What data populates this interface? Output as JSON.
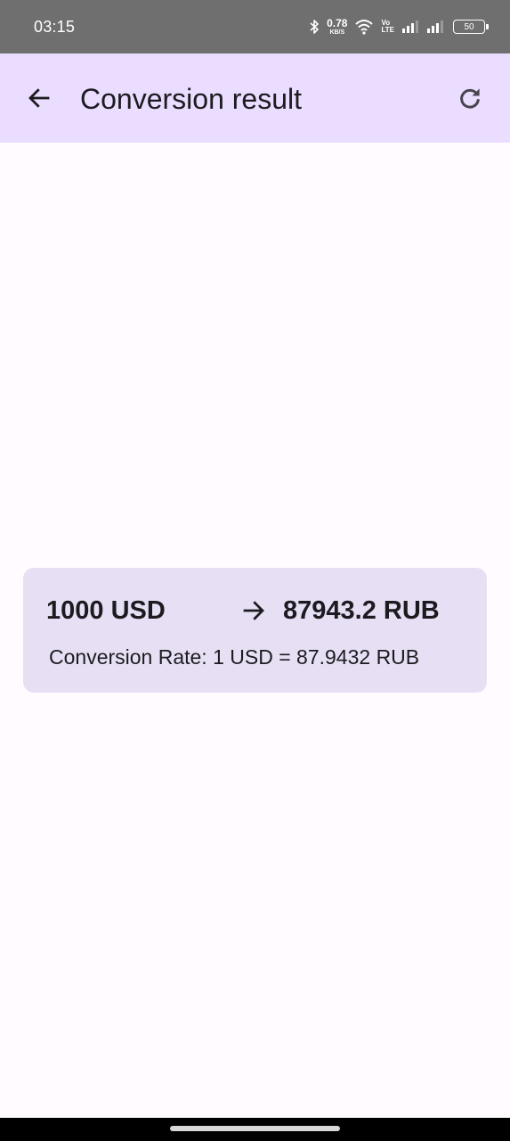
{
  "status_bar": {
    "time": "03:15",
    "net_speed_value": "0.78",
    "net_speed_unit": "KB/S",
    "volte_top": "Vo",
    "volte_bottom": "LTE",
    "battery_level": "50",
    "icons": [
      "bluetooth-icon",
      "wifi-icon",
      "signal-icon",
      "signal-icon"
    ]
  },
  "app_bar": {
    "title": "Conversion result",
    "back_icon": "arrow-left-icon",
    "refresh_icon": "refresh-icon",
    "background_color": "#eaddff"
  },
  "result": {
    "from_amount": "1000 USD",
    "to_amount": "87943.2 RUB",
    "arrow_icon": "arrow-right-icon",
    "rate_text": "Conversion Rate: 1 USD = 87.9432 RUB",
    "card_color": "#e7e0f5"
  }
}
